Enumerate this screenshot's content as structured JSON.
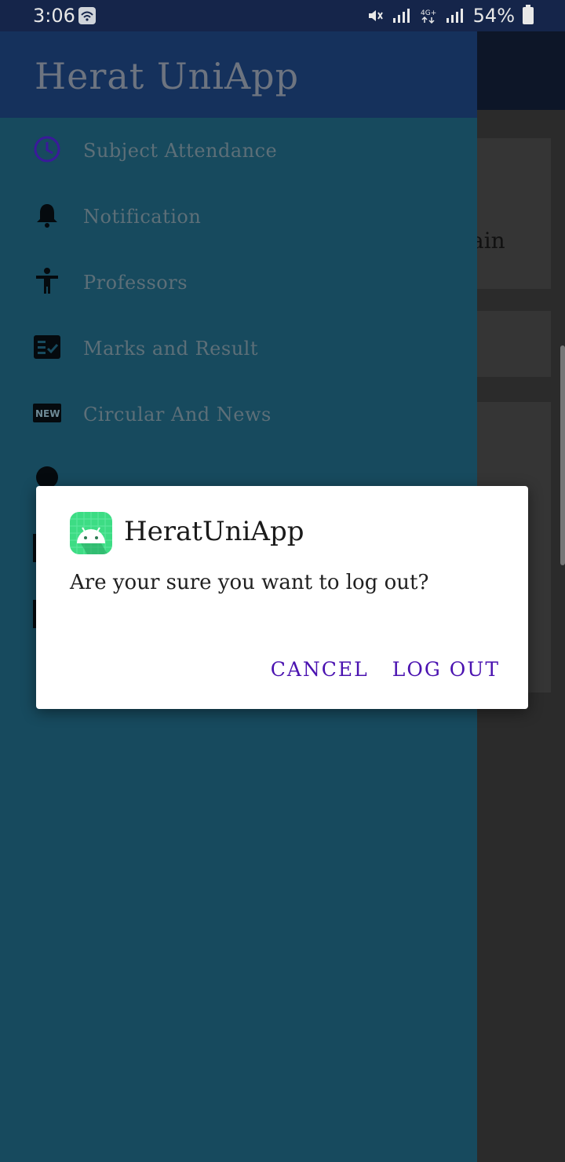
{
  "status_bar": {
    "time": "3:06",
    "battery": "54%",
    "icons": [
      "wifi-icon",
      "mute-icon",
      "signal-icon",
      "4g-icon",
      "battery-icon"
    ]
  },
  "background": {
    "partial_text": "ain"
  },
  "drawer": {
    "title": "Herat UniApp",
    "items": [
      {
        "label": "Subject Attendance",
        "icon": "clock-icon"
      },
      {
        "label": "Notification",
        "icon": "bell-icon"
      },
      {
        "label": "Professors",
        "icon": "person-icon"
      },
      {
        "label": "Marks and Result",
        "icon": "checklist-icon"
      },
      {
        "label": "Circular And News",
        "icon": "new-badge-icon"
      }
    ]
  },
  "dialog": {
    "title": "HeratUniApp",
    "message": "Are your sure you want to log out?",
    "cancel": "CANCEL",
    "logout": "LOG OUT"
  },
  "colors": {
    "drawer_bg": "#174a5e",
    "drawer_header": "#15315c",
    "accent": "#4a12b0",
    "android_green": "#3ddc84"
  }
}
